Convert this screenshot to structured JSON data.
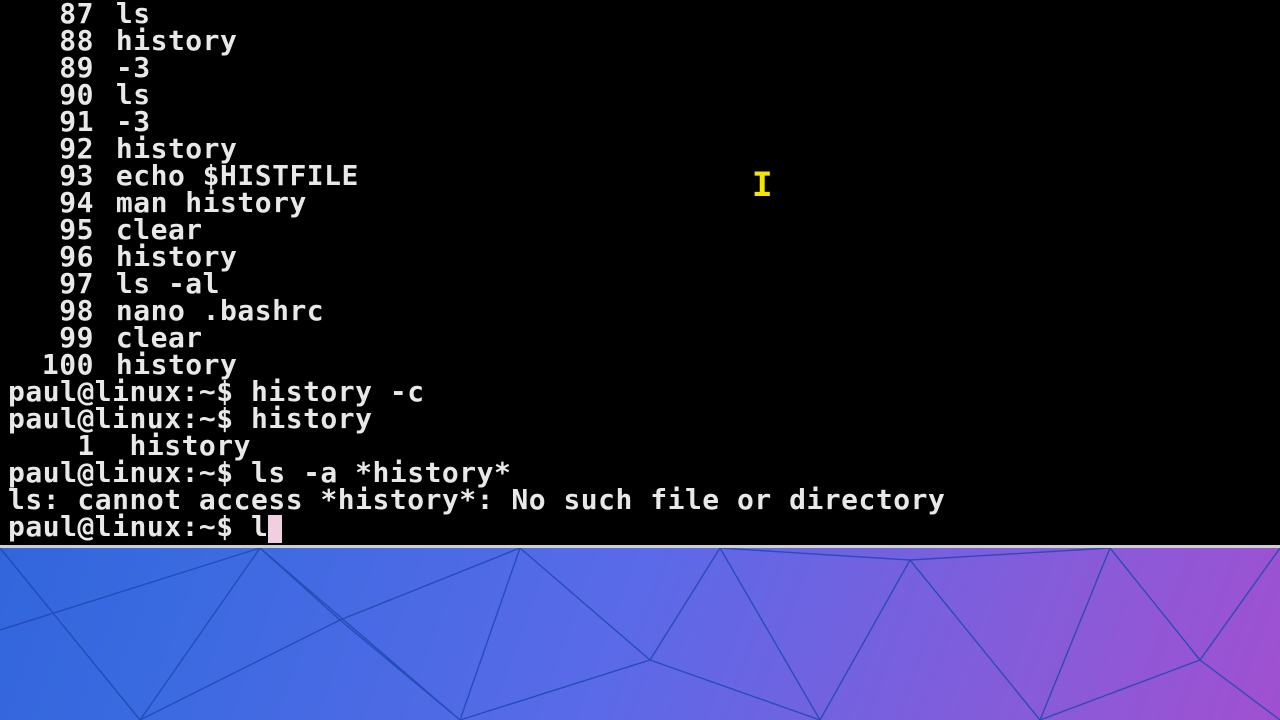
{
  "terminal": {
    "history_rows": [
      {
        "n": "87",
        "c": "ls"
      },
      {
        "n": "88",
        "c": "history"
      },
      {
        "n": "89",
        "c": "-3"
      },
      {
        "n": "90",
        "c": "ls"
      },
      {
        "n": "91",
        "c": "-3"
      },
      {
        "n": "92",
        "c": "history"
      },
      {
        "n": "93",
        "c": "echo $HISTFILE"
      },
      {
        "n": "94",
        "c": "man history"
      },
      {
        "n": "95",
        "c": "clear"
      },
      {
        "n": "96",
        "c": "history"
      },
      {
        "n": "97",
        "c": "ls -al"
      },
      {
        "n": "98",
        "c": "nano .bashrc"
      },
      {
        "n": "99",
        "c": "clear"
      },
      {
        "n": "100",
        "c": "history"
      }
    ],
    "prompt_lines": [
      "paul@linux:~$ history -c",
      "paul@linux:~$ history",
      "    1  history",
      "paul@linux:~$ ls -a *history*",
      "ls: cannot access *history*: No such file or directory"
    ],
    "current_prompt": "paul@linux:~$ ",
    "current_input": "l",
    "ibeam_char": "I"
  }
}
